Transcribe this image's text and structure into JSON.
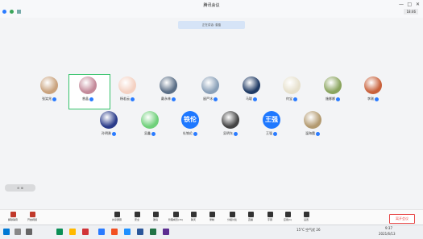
{
  "window": {
    "title": "腾讯会议",
    "time": "18:46"
  },
  "notice": "正在讲话: 曾晶",
  "participants": [
    {
      "name": "张笑兆",
      "color": "#c9a27d"
    },
    {
      "name": "曾晶",
      "color": "#c48a9a"
    },
    {
      "name": "杨若云",
      "color": "#f4d1c2"
    },
    {
      "name": "戴永林",
      "color": "#5a6e86"
    },
    {
      "name": "留严冰",
      "color": "#8aa0b8"
    },
    {
      "name": "马聪",
      "color": "#1f3a64"
    },
    {
      "name": "何宝",
      "color": "#e6e0cc"
    },
    {
      "name": "施娜娜",
      "color": "#8aa45e"
    },
    {
      "name": "李刚",
      "color": "#c8613b"
    },
    {
      "name": "孙明勇",
      "color": "#2a3b8a"
    },
    {
      "name": "吴鑫",
      "color": "#6fd07a"
    },
    {
      "name": "杜铁伦",
      "text": "铁伦"
    },
    {
      "name": "吴明东",
      "color": "#444444"
    },
    {
      "name": "王强",
      "text": "王强"
    },
    {
      "name": "温海霞",
      "color": "#b39a70"
    }
  ],
  "zoom_label": "⊖ ⊕",
  "toolbar": {
    "left": [
      {
        "label": "解除静音"
      },
      {
        "label": "开启视频"
      }
    ],
    "center": [
      {
        "label": "共享屏幕"
      },
      {
        "label": "安全"
      },
      {
        "label": "邀请"
      },
      {
        "label": "管理成员(15)"
      },
      {
        "label": "聊天"
      },
      {
        "label": "录制"
      },
      {
        "label": "分组讨论"
      },
      {
        "label": "直播"
      },
      {
        "label": "字幕"
      },
      {
        "label": "应用(1)"
      },
      {
        "label": "设置"
      }
    ],
    "end": "离开会议"
  },
  "taskbar": {
    "weather": "15°C 空气优 26",
    "time": "9:37",
    "date": "2021/6/13"
  }
}
